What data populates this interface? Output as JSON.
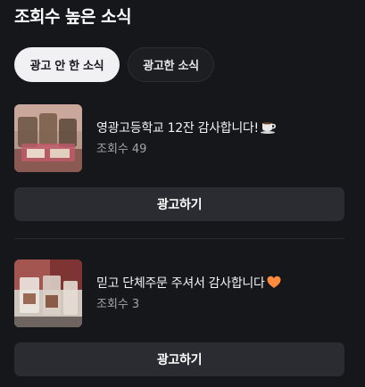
{
  "header": {
    "title": "조회수 높은 소식"
  },
  "tabs": [
    {
      "label": "광고 안 한 소식",
      "active": true
    },
    {
      "label": "광고한 소식",
      "active": false
    }
  ],
  "posts": [
    {
      "title": "영광고등학교 12잔 감사합니다!",
      "emoji": "coffee-cup-icon",
      "views_label": "조회수",
      "views": "49",
      "button_label": "광고하기"
    },
    {
      "title": "믿고 단체주문 주셔서 감사합니다",
      "emoji": "orange-heart-icon",
      "views_label": "조회수",
      "views": "3",
      "button_label": "광고하기"
    }
  ],
  "colors": {
    "background": "#16171b",
    "button": "#2a2c31",
    "active_tab": "#f1f1f3",
    "heart": "#ff8a3d"
  }
}
